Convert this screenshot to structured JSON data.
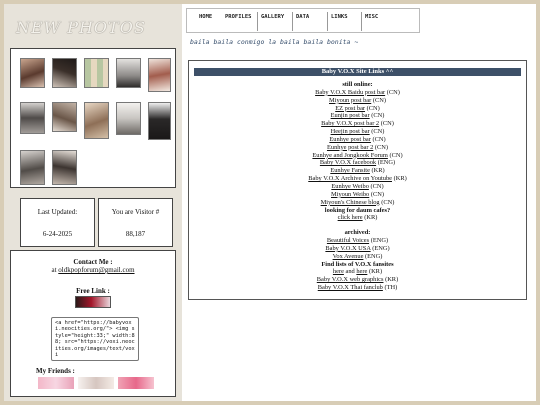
{
  "sidebar": {
    "title": "NEW PHOTOS",
    "last_updated_label": "Last Updated:",
    "last_updated_value": "6-24-2025",
    "visitor_label": "You are Visitor #",
    "visitor_value": "88,187",
    "contact_title": "Contact Me :",
    "contact_prefix": "at",
    "contact_email": "oldkpopforum@gmail.com",
    "free_link_title": "Free Link :",
    "code_text": "<a href=\"https://babyvoxi.neocities.org/\"> <img style=\"height:33;\" width:88; src=\"https://voxi.neocities.org/images/text/voxi",
    "friends_title": "My Friends :"
  },
  "nav": {
    "items": [
      "HOME",
      "PROFILES",
      "GALLERY",
      "DATA",
      "LINKS",
      "MISC"
    ]
  },
  "marquee_text": "baila baila conmigo la baila baila bonita ~",
  "main": {
    "header": "Baby V.O.X Site Links ^^",
    "still_online_title": "still online:",
    "links": [
      {
        "text": "Baby V.O.X Baidu post bar",
        "suffix": " (CN)"
      },
      {
        "text": "Miyoun post bar",
        "suffix": " (CN)"
      },
      {
        "text": "EZ post bar",
        "suffix": " (CN)"
      },
      {
        "text": "Eunjin post bar",
        "suffix": " (CN)"
      },
      {
        "text": "Baby V.O.X post bar 2",
        "suffix": " (CN)"
      },
      {
        "text": "Heejin post bar",
        "suffix": " (CN)"
      },
      {
        "text": "Eunhye post bar",
        "suffix": " (CN)"
      },
      {
        "text": "Eunhye post bar 2",
        "suffix": " (CN)"
      },
      {
        "text": "Eunhye and Jongkook Forum",
        "suffix": " (CN)"
      },
      {
        "text": "Baby V.O.X facebook",
        "suffix": " (ENG)"
      },
      {
        "text": "Eunhye Fansite",
        "suffix": " (KR)"
      },
      {
        "text": "Baby V.O.X Archive on Youtube",
        "suffix": " (KR)"
      },
      {
        "text": "Eunhye Weibo",
        "suffix": " (CN)"
      },
      {
        "text": "Miyoun Weibo",
        "suffix": " (CN)"
      },
      {
        "text": "Miyoun's Chinese blog",
        "suffix": " (CN)"
      }
    ],
    "daum_title": "looking for daum cafes?",
    "daum_link": {
      "text": "click here",
      "suffix": " (KR)"
    },
    "archived_title": "archived:",
    "archived_links": [
      {
        "text": "Beautiful Voices",
        "suffix": " (ENG)"
      },
      {
        "text": "Baby V.O.X USA",
        "suffix": " (ENG)"
      },
      {
        "text": "Vox Avenue",
        "suffix": " (ENG)"
      }
    ],
    "fansites_title": "Find lists of V.O.X fansites",
    "fansites_line": {
      "a": "here",
      "mid": " and ",
      "b": "here",
      "suffix": " (KR)"
    },
    "extra_links": [
      {
        "text": "Baby V.O.X web graphics",
        "suffix": " (KR)"
      },
      {
        "text": "Baby V.O.X Thai fanclub",
        "suffix": " (TH)"
      }
    ]
  },
  "colors": {
    "background": "#d8cdb6",
    "sidebar": "#e7e3da",
    "header_bar": "#3d5068",
    "marquee": "#344c6a"
  }
}
